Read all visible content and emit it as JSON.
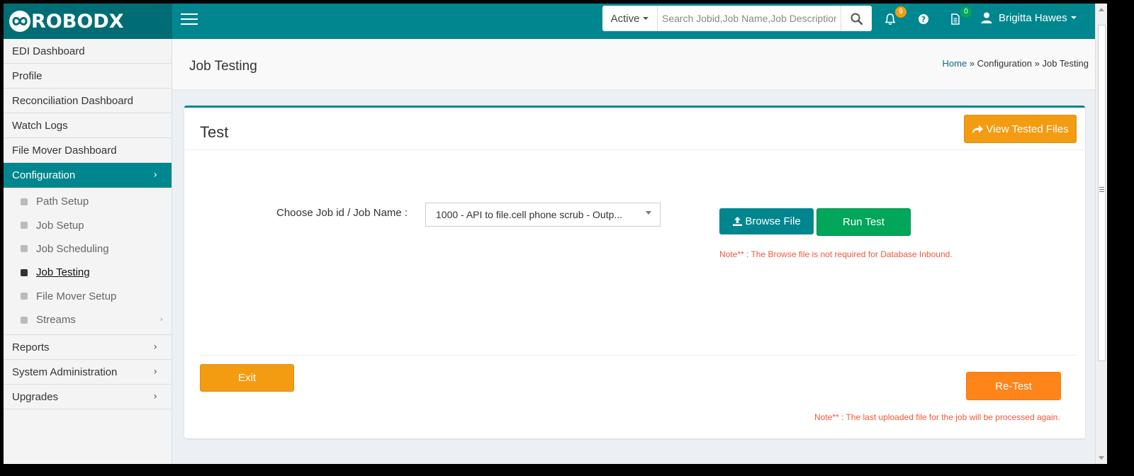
{
  "brand": {
    "name": "ROBODX"
  },
  "topbar": {
    "status_filter": "Active",
    "search_placeholder": "Search Jobid,Job Name,Job Description,Inbound",
    "notifications_count": "9",
    "notifications_badge_color": "#f39c12",
    "documents_count": "0",
    "documents_badge_color": "#00a65a",
    "user_name": "Brigitta Hawes"
  },
  "sidebar": {
    "items": [
      {
        "label": "EDI Dashboard"
      },
      {
        "label": "Profile"
      },
      {
        "label": "Reconciliation Dashboard"
      },
      {
        "label": "Watch Logs"
      },
      {
        "label": "File Mover Dashboard"
      },
      {
        "label": "Configuration",
        "active": true
      }
    ],
    "sub_items": [
      {
        "label": "Path Setup"
      },
      {
        "label": "Job Setup"
      },
      {
        "label": "Job Scheduling"
      },
      {
        "label": "Job Testing",
        "current": true
      },
      {
        "label": "File Mover Setup"
      },
      {
        "label": "Streams"
      }
    ],
    "bottom_items": [
      {
        "label": "Reports"
      },
      {
        "label": "System Administration"
      },
      {
        "label": "Upgrades"
      }
    ]
  },
  "page": {
    "title": "Job Testing",
    "breadcrumb": {
      "home": "Home",
      "sep1": " » ",
      "section": "Configuration",
      "sep2": " » ",
      "current": "Job Testing"
    }
  },
  "box": {
    "title": "Test",
    "view_tested_label": "View Tested Files",
    "choose_label": "Choose Job id / Job Name :",
    "selected_job": "1000 - API to file.cell phone scrub - Outp...",
    "browse_label": "Browse File",
    "run_label": "Run Test",
    "browse_note": "Note** : The Browse file is not required for Database Inbound.",
    "exit_label": "Exit",
    "retest_label": "Re-Test",
    "retest_note": "Note** : The last uploaded file for the job will be processed again."
  },
  "colors": {
    "brand_dark": "#006d75",
    "brand": "#00868e",
    "warning": "#f39c12",
    "success": "#00a65a",
    "orange": "#ff851b",
    "note_red": "#f0573a"
  },
  "icons": {
    "menu": "hamburger-icon",
    "search": "search-icon",
    "notifications": "bell-icon",
    "help": "question-circle-icon",
    "documents": "document-icon",
    "user": "user-icon",
    "view_tested": "share-icon",
    "browse": "upload-icon"
  }
}
